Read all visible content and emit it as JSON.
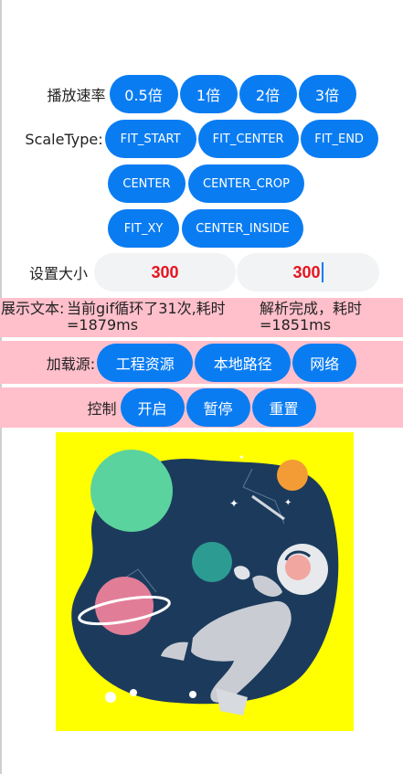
{
  "speed": {
    "label": "播放速率",
    "options": [
      "0.5倍",
      "1倍",
      "2倍",
      "3倍"
    ]
  },
  "scale_type": {
    "label": "ScaleType:",
    "options": [
      "FIT_START",
      "FIT_CENTER",
      "FIT_END",
      "CENTER",
      "CENTER_CROP",
      "FIT_XY",
      "CENTER_INSIDE"
    ]
  },
  "size": {
    "label": "设置大小",
    "width_value": "300",
    "height_value": "300"
  },
  "display": {
    "label": "展示文本:",
    "loop_text": "当前gif循环了31次,耗时=1879ms",
    "parse_text": "解析完成，耗时=1851ms"
  },
  "source": {
    "label": "加载源:",
    "options": [
      "工程资源",
      "本地路径",
      "网络"
    ]
  },
  "control": {
    "label": "控制",
    "options": [
      "开启",
      "暂停",
      "重置"
    ]
  },
  "colors": {
    "button": "#0a7cf2",
    "pink_bg": "#ffc0cb",
    "image_bg": "#ffff00",
    "input_value": "#e8131f"
  }
}
